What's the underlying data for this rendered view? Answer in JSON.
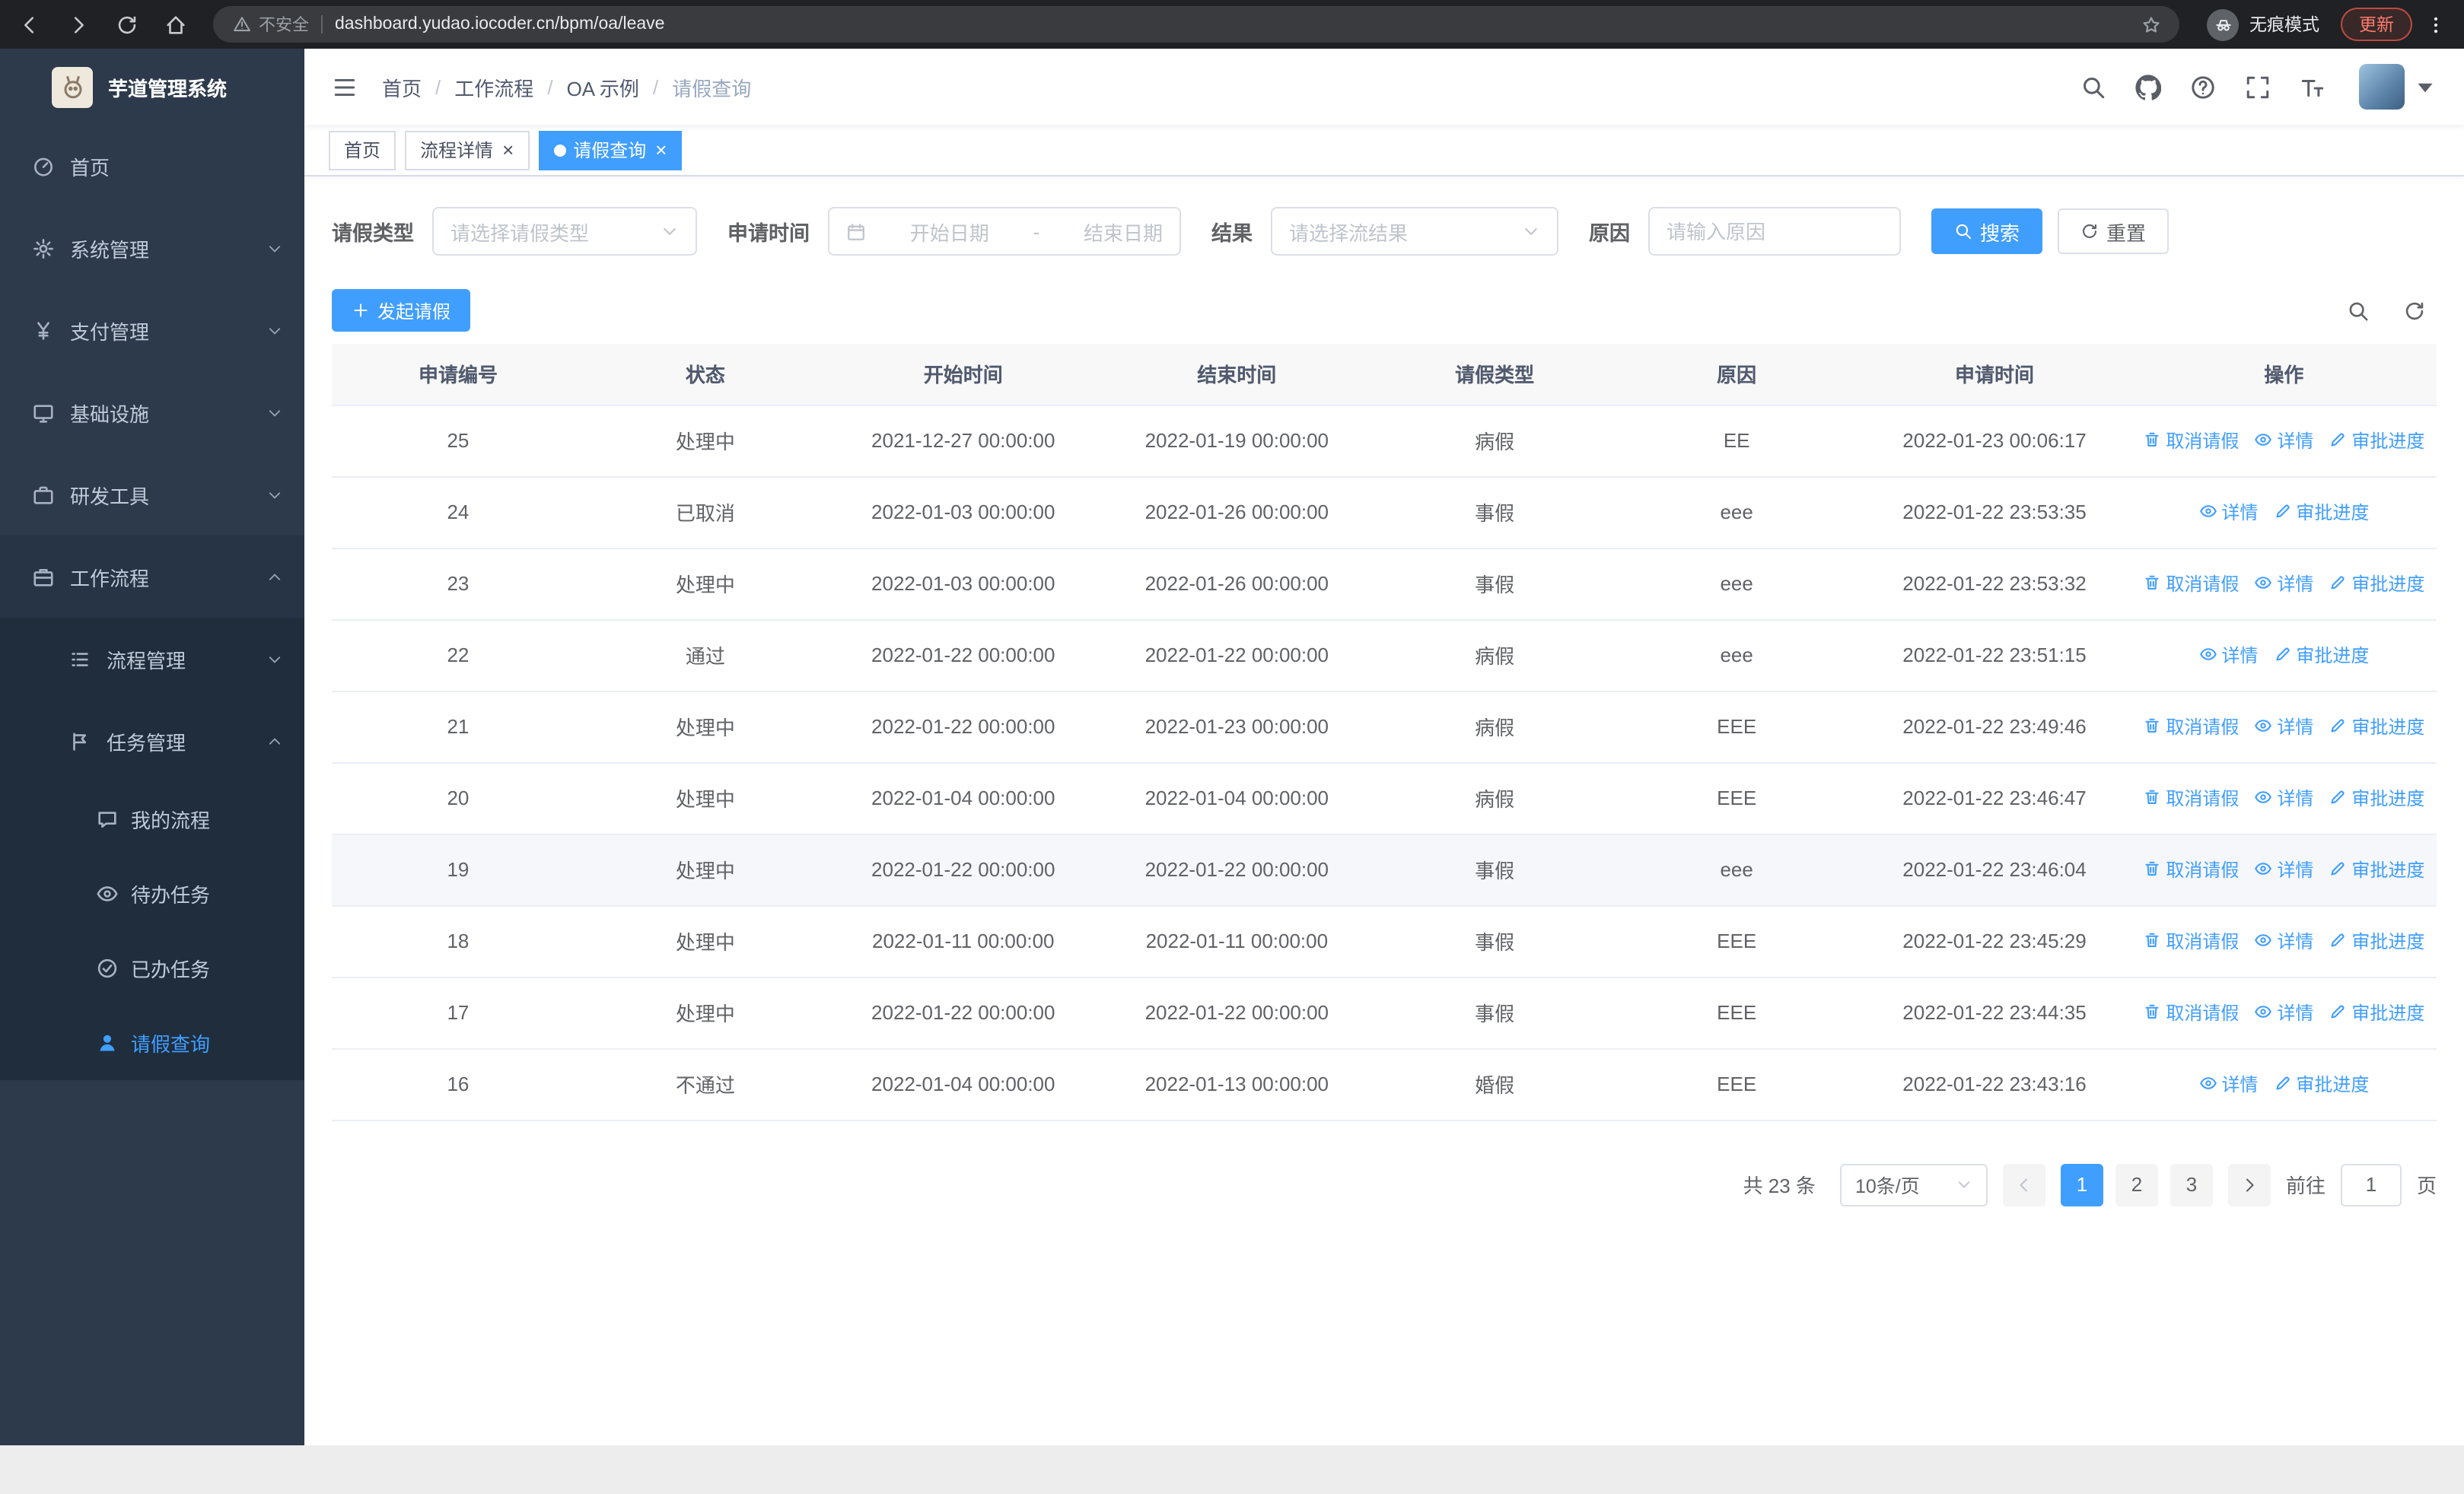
{
  "browser": {
    "security_label": "不安全",
    "url": "dashboard.yudao.iocoder.cn/bpm/oa/leave",
    "incognito_label": "无痕模式",
    "update_label": "更新",
    "nav_icons": [
      "arrow-left-icon",
      "arrow-right-icon",
      "refresh-icon",
      "home-icon"
    ]
  },
  "sidebar": {
    "logo_title": "芋道管理系统",
    "menu": [
      {
        "label": "首页",
        "icon": "dashboard-icon",
        "level": 1
      },
      {
        "label": "系统管理",
        "icon": "gear-icon",
        "level": 1,
        "chevron": "down"
      },
      {
        "label": "支付管理",
        "icon": "yen-icon",
        "level": 1,
        "chevron": "down"
      },
      {
        "label": "基础设施",
        "icon": "monitor-icon",
        "level": 1,
        "chevron": "down"
      },
      {
        "label": "研发工具",
        "icon": "briefcase-icon",
        "level": 1,
        "chevron": "down"
      },
      {
        "label": "工作流程",
        "icon": "workflow-icon",
        "level": 1,
        "chevron": "up",
        "open": true
      },
      {
        "label": "流程管理",
        "icon": "process-icon",
        "level": 2,
        "chevron": "down"
      },
      {
        "label": "任务管理",
        "icon": "task-icon",
        "level": 2,
        "chevron": "up",
        "open": true
      },
      {
        "label": "我的流程",
        "icon": "chat-icon",
        "level": 3
      },
      {
        "label": "待办任务",
        "icon": "eye-icon",
        "level": 3
      },
      {
        "label": "已办任务",
        "icon": "check-icon",
        "level": 3
      },
      {
        "label": "请假查询",
        "icon": "user-icon",
        "level": 3,
        "active": true
      }
    ]
  },
  "header": {
    "breadcrumb": [
      "首页",
      "工作流程",
      "OA 示例",
      "请假查询"
    ],
    "right_icons": [
      "search-icon",
      "github-icon",
      "question-icon",
      "fullscreen-icon",
      "fontsize-icon"
    ]
  },
  "tabs": [
    {
      "label": "首页",
      "closable": false,
      "active": false
    },
    {
      "label": "流程详情",
      "closable": true,
      "active": false
    },
    {
      "label": "请假查询",
      "closable": true,
      "active": true
    }
  ],
  "filters": {
    "leave_type_label": "请假类型",
    "leave_type_placeholder": "请选择请假类型",
    "apply_time_label": "申请时间",
    "start_date_placeholder": "开始日期",
    "date_separator": "-",
    "end_date_placeholder": "结束日期",
    "result_label": "结果",
    "result_placeholder": "请选择流结果",
    "reason_label": "原因",
    "reason_placeholder": "请输入原因",
    "search_label": "搜索",
    "reset_label": "重置"
  },
  "toolbar": {
    "create_label": "发起请假"
  },
  "table": {
    "columns": [
      "申请编号",
      "状态",
      "开始时间",
      "结束时间",
      "请假类型",
      "原因",
      "申请时间",
      "操作"
    ],
    "actions": {
      "cancel": "取消请假",
      "detail": "详情",
      "progress": "审批进度"
    },
    "rows": [
      {
        "id": "25",
        "status": "处理中",
        "start": "2021-12-27 00:00:00",
        "end": "2022-01-19 00:00:00",
        "type": "病假",
        "reason": "EE",
        "apply_time": "2022-01-23 00:06:17",
        "cancellable": true
      },
      {
        "id": "24",
        "status": "已取消",
        "start": "2022-01-03 00:00:00",
        "end": "2022-01-26 00:00:00",
        "type": "事假",
        "reason": "eee",
        "apply_time": "2022-01-22 23:53:35",
        "cancellable": false
      },
      {
        "id": "23",
        "status": "处理中",
        "start": "2022-01-03 00:00:00",
        "end": "2022-01-26 00:00:00",
        "type": "事假",
        "reason": "eee",
        "apply_time": "2022-01-22 23:53:32",
        "cancellable": true
      },
      {
        "id": "22",
        "status": "通过",
        "start": "2022-01-22 00:00:00",
        "end": "2022-01-22 00:00:00",
        "type": "病假",
        "reason": "eee",
        "apply_time": "2022-01-22 23:51:15",
        "cancellable": false
      },
      {
        "id": "21",
        "status": "处理中",
        "start": "2022-01-22 00:00:00",
        "end": "2022-01-23 00:00:00",
        "type": "病假",
        "reason": "EEE",
        "apply_time": "2022-01-22 23:49:46",
        "cancellable": true
      },
      {
        "id": "20",
        "status": "处理中",
        "start": "2022-01-04 00:00:00",
        "end": "2022-01-04 00:00:00",
        "type": "病假",
        "reason": "EEE",
        "apply_time": "2022-01-22 23:46:47",
        "cancellable": true
      },
      {
        "id": "19",
        "status": "处理中",
        "start": "2022-01-22 00:00:00",
        "end": "2022-01-22 00:00:00",
        "type": "事假",
        "reason": "eee",
        "apply_time": "2022-01-22 23:46:04",
        "cancellable": true,
        "hover": true
      },
      {
        "id": "18",
        "status": "处理中",
        "start": "2022-01-11 00:00:00",
        "end": "2022-01-11 00:00:00",
        "type": "事假",
        "reason": "EEE",
        "apply_time": "2022-01-22 23:45:29",
        "cancellable": true
      },
      {
        "id": "17",
        "status": "处理中",
        "start": "2022-01-22 00:00:00",
        "end": "2022-01-22 00:00:00",
        "type": "事假",
        "reason": "EEE",
        "apply_time": "2022-01-22 23:44:35",
        "cancellable": true
      },
      {
        "id": "16",
        "status": "不通过",
        "start": "2022-01-04 00:00:00",
        "end": "2022-01-13 00:00:00",
        "type": "婚假",
        "reason": "EEE",
        "apply_time": "2022-01-22 23:43:16",
        "cancellable": false
      }
    ]
  },
  "pagination": {
    "total_label": "共 23 条",
    "page_size_label": "10条/页",
    "pages": [
      "1",
      "2",
      "3"
    ],
    "active_page": "1",
    "goto_label": "前往",
    "goto_value": "1",
    "unit_label": "页"
  },
  "colors": {
    "accent": "#409eff",
    "sidebar_bg": "#2d3a4b",
    "submenu_bg": "#1f2d3d",
    "chrome_bg": "#202124",
    "update_pill": "#ff7b6e"
  }
}
